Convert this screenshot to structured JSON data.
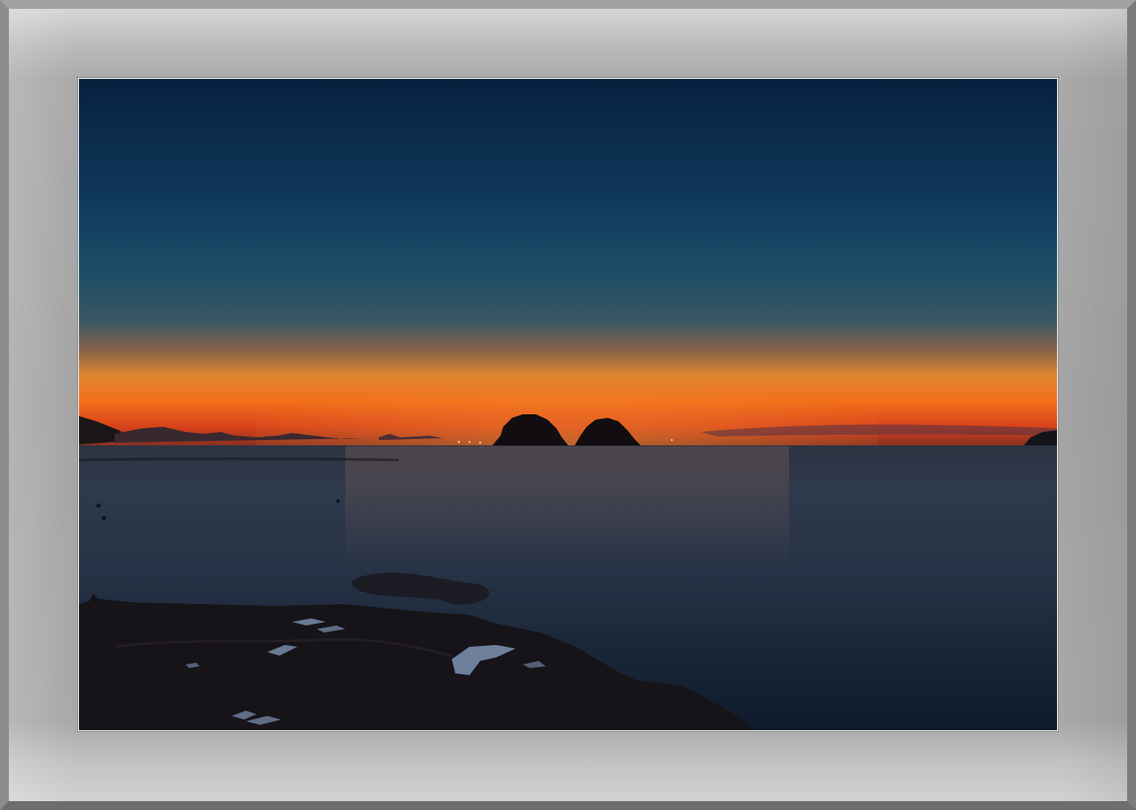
{
  "frame": {
    "mat_color": "#a6a6a6",
    "outer_border_color": "#8e8e8e",
    "inner_border_color": "#f2f2f2"
  },
  "photo": {
    "scene": "sunset-over-sea",
    "colors": {
      "sky_top": "#07213f",
      "sky_mid": "#1d5270",
      "horizon_glow": "#f0781e",
      "horizon_red": "#d4401c",
      "sea": "#1f2a3a",
      "rocks": "#15151a"
    }
  }
}
